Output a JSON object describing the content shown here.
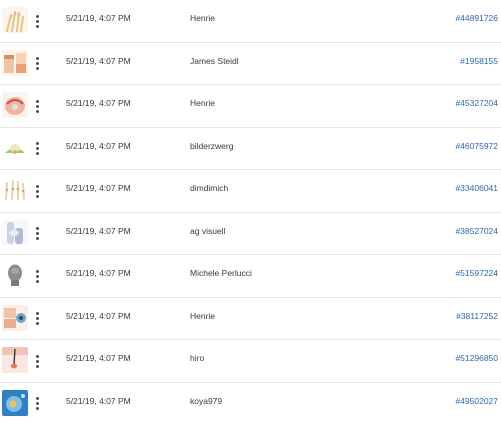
{
  "rows": [
    {
      "thumb_icon": "hand-joints-icon",
      "date": "5/21/19, 4:07 PM",
      "author": "Henrie",
      "id": "#44891726"
    },
    {
      "thumb_icon": "skin-layers-icon",
      "date": "5/21/19, 4:07 PM",
      "author": "James Steidl",
      "id": "#1958155"
    },
    {
      "thumb_icon": "shoulder-anatomy-icon",
      "date": "5/21/19, 4:07 PM",
      "author": "Henrie",
      "id": "#45327204"
    },
    {
      "thumb_icon": "vertebra-icon",
      "date": "5/21/19, 4:07 PM",
      "author": "bilderzwerg",
      "id": "#46075972"
    },
    {
      "thumb_icon": "finger-bones-icon",
      "date": "5/21/19, 4:07 PM",
      "author": "dimdimich",
      "id": "#33406041"
    },
    {
      "thumb_icon": "knee-joint-icon",
      "date": "5/21/19, 4:07 PM",
      "author": "ag visuell",
      "id": "#38527024"
    },
    {
      "thumb_icon": "head-model-icon",
      "date": "5/21/19, 4:07 PM",
      "author": "Michele Perlucci",
      "id": "#51597224"
    },
    {
      "thumb_icon": "eye-anatomy-icon",
      "date": "5/21/19, 4:07 PM",
      "author": "Henrie",
      "id": "#38117252"
    },
    {
      "thumb_icon": "hair-follicle-icon",
      "date": "5/21/19, 4:07 PM",
      "author": "hiro",
      "id": "#51296850"
    },
    {
      "thumb_icon": "cell-icon",
      "date": "5/21/19, 4:07 PM",
      "author": "koya979",
      "id": "#49502027"
    }
  ]
}
